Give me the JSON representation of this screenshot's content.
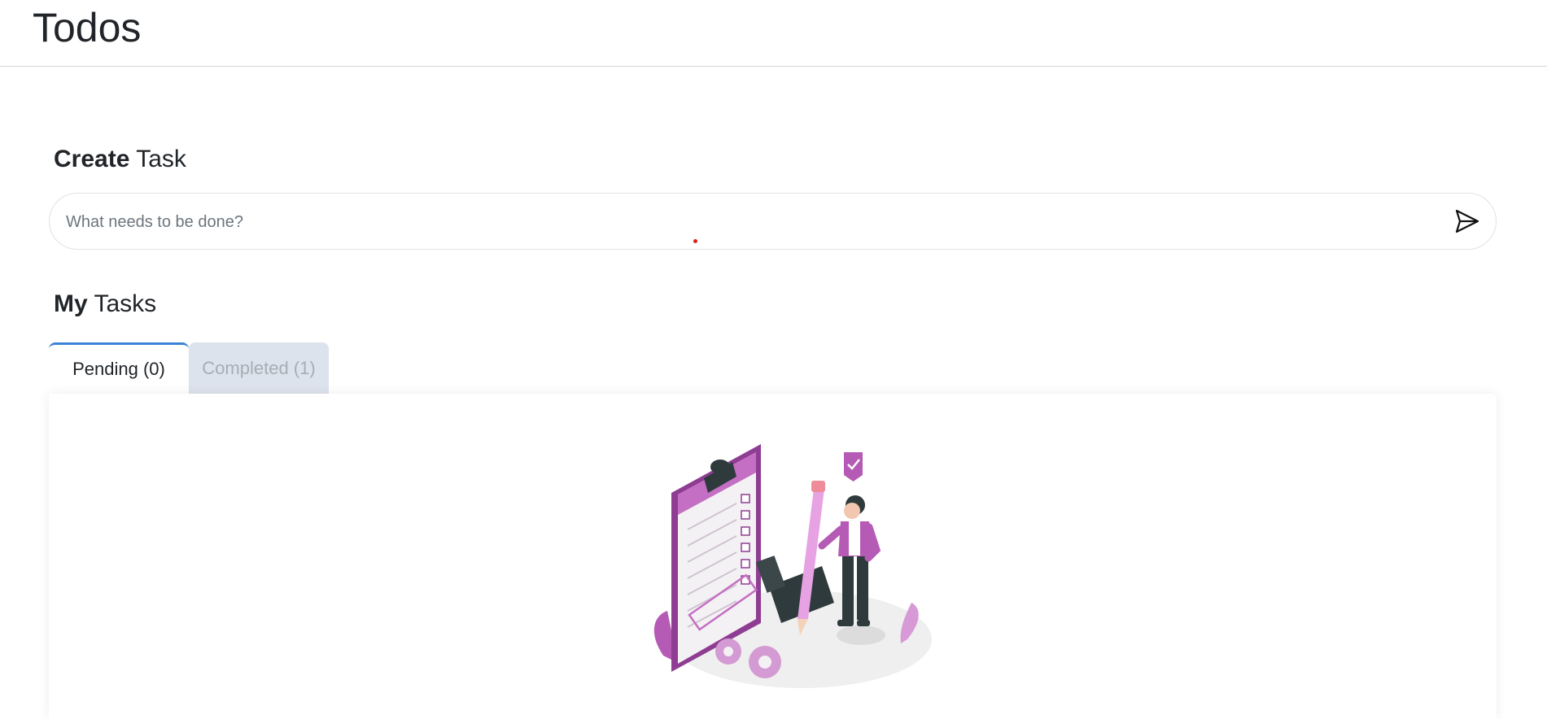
{
  "header": {
    "title": "Todos"
  },
  "create": {
    "title_bold": "Create",
    "title_rest": "Task",
    "input": {
      "placeholder": "What needs to be done?",
      "value": ""
    },
    "submit_icon": "send-icon"
  },
  "tasks": {
    "title_bold": "My",
    "title_rest": "Tasks",
    "tabs": [
      {
        "label": "Pending (0)",
        "active": true
      },
      {
        "label": "Completed (1)",
        "active": false
      }
    ],
    "empty_state_image": "completed-tasks-illustration"
  },
  "colors": {
    "active_tab_border": "#3b82d6",
    "inactive_tab_bg": "#dde3ec",
    "illustration_accent": "#a44ba8"
  }
}
